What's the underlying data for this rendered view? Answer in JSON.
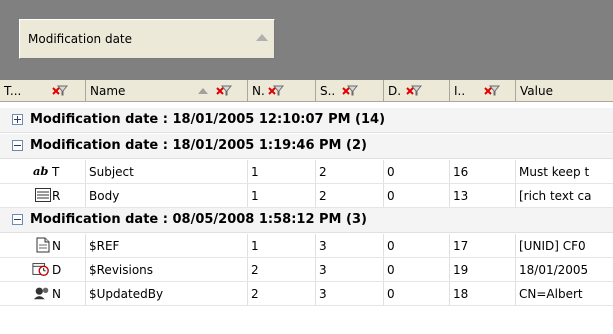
{
  "group_panel": {
    "chip_label": "Modification date"
  },
  "columns": {
    "type": "T...",
    "name": "Name",
    "n": "N.",
    "s": "S..",
    "d": "D.",
    "i": "I..",
    "value": "Value"
  },
  "groups": [
    {
      "label": "Modification date : 18/01/2005 12:10:07 PM (14)",
      "expanded": false
    },
    {
      "label": "Modification date : 18/01/2005 1:19:46 PM (2)",
      "expanded": true
    },
    {
      "label": "Modification date : 08/05/2008 1:58:12 PM (3)",
      "expanded": true
    }
  ],
  "rows": [
    {
      "icon": "text-ab-icon",
      "type": "T",
      "name": "Subject",
      "n": "1",
      "s": "2",
      "d": "0",
      "i": "16",
      "value": "Must keep t"
    },
    {
      "icon": "rich-text-icon",
      "type": "R",
      "name": "Body",
      "n": "1",
      "s": "2",
      "d": "0",
      "i": "13",
      "value": "[rich text ca"
    },
    {
      "icon": "document-icon",
      "type": "N",
      "name": "$REF",
      "n": "1",
      "s": "3",
      "d": "0",
      "i": "17",
      "value": "[UNID] CF0"
    },
    {
      "icon": "date-time-icon",
      "type": "D",
      "name": "$Revisions",
      "n": "2",
      "s": "3",
      "d": "0",
      "i": "19",
      "value": "18/01/2005"
    },
    {
      "icon": "names-icon",
      "type": "N",
      "name": "$UpdatedBy",
      "n": "2",
      "s": "3",
      "d": "0",
      "i": "18",
      "value": "CN=Albert"
    }
  ]
}
